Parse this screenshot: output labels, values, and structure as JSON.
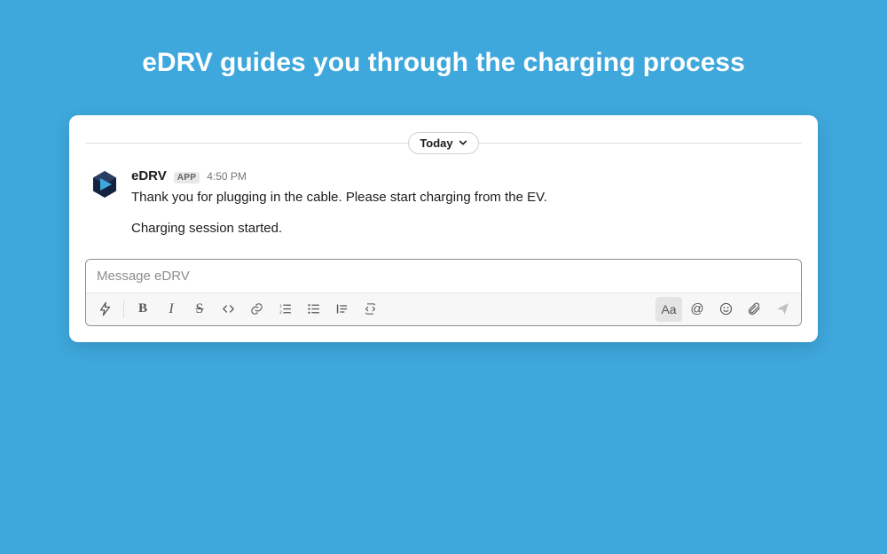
{
  "headline": "eDRV guides you through the charging process",
  "date_divider": {
    "label": "Today"
  },
  "message": {
    "sender": "eDRV",
    "badge": "APP",
    "time": "4:50 PM",
    "line1": "Thank you for plugging in the cable. Please start charging from the EV.",
    "line2": "Charging session started."
  },
  "composer": {
    "placeholder": "Message eDRV",
    "bold_glyph": "B",
    "italic_glyph": "I",
    "strike_glyph": "S",
    "aa_glyph": "Aa",
    "mention_glyph": "@"
  }
}
